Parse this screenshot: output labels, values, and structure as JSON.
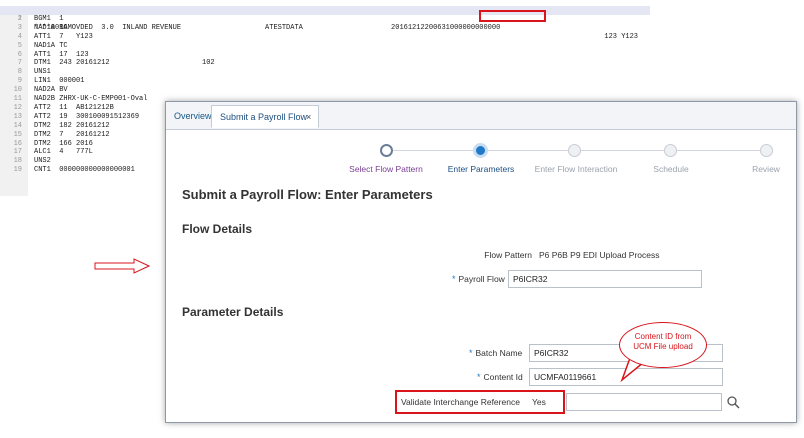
{
  "edi_file": {
    "lines": [
      {
        "n": "1",
        "text": "****001AMOVDED  3.0  INLAND REVENUE                    ATESTDATA                     20161212200631000000000000",
        "right": "123 Y123"
      },
      {
        "n": "2",
        "text": "BGM1  1"
      },
      {
        "n": "3",
        "text": "NAD1A BG"
      },
      {
        "n": "4",
        "text": "ATT1  7   Y123"
      },
      {
        "n": "5",
        "text": "NAD1A TC"
      },
      {
        "n": "6",
        "text": "ATT1  17  123"
      },
      {
        "n": "7",
        "text": "DTM1  243 20161212                      102"
      },
      {
        "n": "8",
        "text": "UNS1"
      },
      {
        "n": "9",
        "text": "LIN1  000001"
      },
      {
        "n": "10",
        "text": "NAD2A BV"
      },
      {
        "n": "11",
        "text": "NAD2B ZHRX-UK-C-EMP001-Oval"
      },
      {
        "n": "12",
        "text": "ATT2  11  AB121212B"
      },
      {
        "n": "13",
        "text": "ATT2  19  300100091512369"
      },
      {
        "n": "14",
        "text": "DTM2  182 20161212"
      },
      {
        "n": "15",
        "text": "DTM2  7   20161212"
      },
      {
        "n": "16",
        "text": "DTM2  166 2016"
      },
      {
        "n": "17",
        "text": "ALC1  4   777L"
      },
      {
        "n": "18",
        "text": "UNS2"
      },
      {
        "n": "19",
        "text": "CNT1  000000000000000001"
      }
    ]
  },
  "tabs": {
    "overview": "Overview",
    "active": "Submit a Payroll Flow",
    "close_glyph": "×"
  },
  "train": {
    "steps": [
      {
        "label": "Select Flow Pattern",
        "state": "done"
      },
      {
        "label": "Enter Parameters",
        "state": "current"
      },
      {
        "label": "Enter Flow Interaction",
        "state": "future"
      },
      {
        "label": "Schedule",
        "state": "future"
      },
      {
        "label": "Review",
        "state": "future"
      }
    ]
  },
  "page": {
    "title": "Submit a Payroll Flow: Enter Parameters",
    "flow_details_title": "Flow Details",
    "parameter_details_title": "Parameter Details"
  },
  "fields": {
    "flow_pattern_label": "Flow Pattern",
    "flow_pattern_value": "P6 P6B P9 EDI Upload Process",
    "required_mark": "*",
    "payroll_flow_label": "Payroll Flow",
    "payroll_flow_value": "P6ICR32",
    "batch_name_label": "Batch Name",
    "batch_name_value": "P6ICR32",
    "content_id_label": "Content Id",
    "content_id_value": "UCMFA0119661",
    "validate_label": "Validate Interchange Reference",
    "validate_value": "Yes"
  },
  "callout": {
    "line1": "Content ID from",
    "line2": "UCM File upload"
  },
  "icons": {
    "search": "search-icon",
    "arrow": "hollow-arrow-icon",
    "close": "close-icon"
  },
  "colors": {
    "annotation_red": "#d9141b",
    "link_blue": "#15598a",
    "train_current": "#1f79c8",
    "train_done_label": "#7a3e91"
  }
}
